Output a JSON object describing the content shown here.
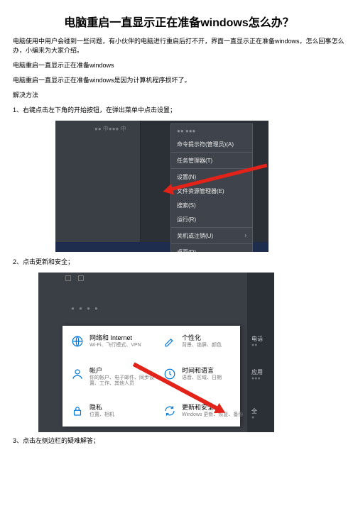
{
  "title": "电脑重启一直显示正在准备windows怎么办？",
  "intro": "电脑使用中用户会碰到一些问题，有小伙伴的电脑进行重启后打不开，界面一直显示正在准备windows，怎么回事怎么办，小编来为大家介绍。",
  "line2": "电脑重启一直显示正在准备windows",
  "line3": "电脑重启一直显示正在准备windows是因为计算机程序损坏了。",
  "line4": "解决方法",
  "step1": "1、右键点击左下角的开始按钮，在弹出菜单中点击设置；",
  "step2": "2、点击更新和安全；",
  "step3": "3、点击左侧边栏的疑难解答；",
  "shot1": {
    "hint": "●●  中●●●  中",
    "menu": {
      "dim": "●● ●●●",
      "i1": "命令提示符(管理员)(A)",
      "i2": "任务管理器(T)",
      "i3": "设置(N)",
      "i4": "文件资源管理器(E)",
      "i5": "搜索(S)",
      "i6": "运行(R)",
      "i7": "关机或注销(U)",
      "i8": "桌面(D)"
    }
  },
  "shot2": {
    "hintbar": "●  ●  ●  ●",
    "cells": {
      "network": {
        "title": "网络和 Internet",
        "sub": "Wi-Fi、飞行模式、VPN"
      },
      "personal": {
        "title": "个性化",
        "sub": "背景、锁屏、颜色"
      },
      "account": {
        "title": "帐户",
        "sub": "你的帐户、电子邮件、同步设置、工作、其他人员"
      },
      "time": {
        "title": "时间和语言",
        "sub": "语音、区域、日期"
      },
      "privacy": {
        "title": "隐私",
        "sub": "位置、相机"
      },
      "update": {
        "title": "更新和安全",
        "sub": "Windows 更新、恢复、备份"
      }
    },
    "side": {
      "c1t": "电话",
      "c1s": "●●",
      "c2t": "应用",
      "c2s": "●●●",
      "c3t": "全",
      "c3s": "●"
    }
  }
}
